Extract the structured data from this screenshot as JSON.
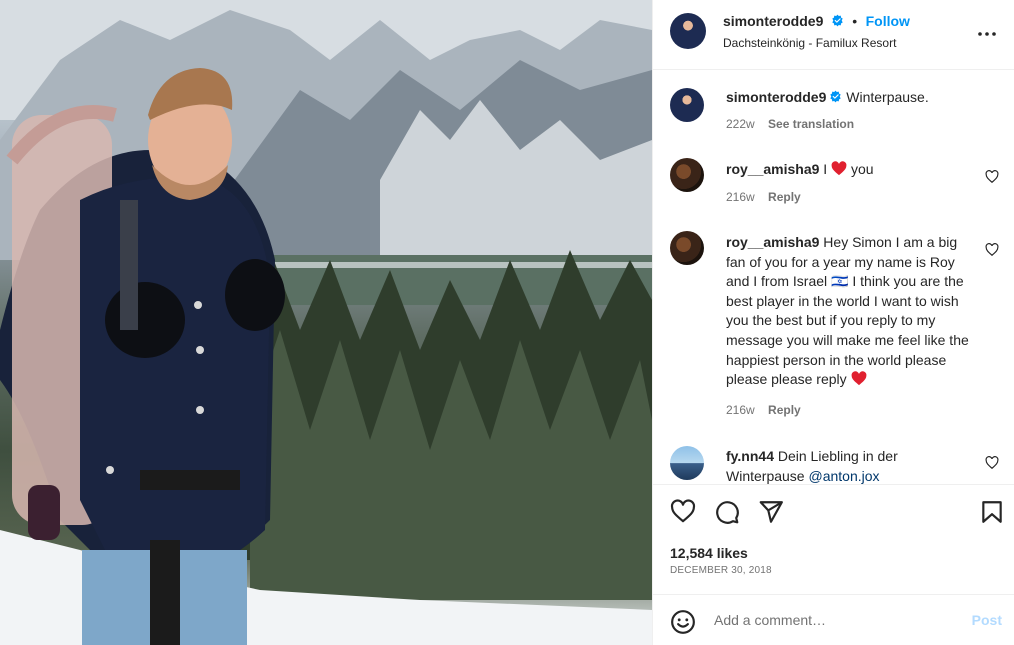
{
  "post": {
    "owner": {
      "username": "simonterodde9",
      "follow_label": "Follow",
      "separator": "•",
      "location": "Dachsteinkönig - Familux Resort"
    },
    "caption": {
      "username": "simonterodde9",
      "text": "Winterpause.",
      "age": "222w",
      "translate_label": "See translation"
    },
    "comments": [
      {
        "username": "roy__amisha9",
        "text_before": "I",
        "text_after": "you",
        "age": "216w",
        "reply_label": "Reply"
      },
      {
        "username": "roy__amisha9",
        "text": "Hey Simon I am a big fan of you for a year my name is Roy and I from Israel 🇮🇱 I think you are the best player in the world I want to wish you the best but if you reply to my message you will make me feel like the happiest person in the world please please please reply",
        "age": "216w",
        "reply_label": "Reply"
      },
      {
        "username": "fy.nn44",
        "text": "Dein Liebling in der Winterpause",
        "mention": "@anton.jox"
      }
    ],
    "likes": "12,584 likes",
    "date": "December 30, 2018",
    "add_comment_placeholder": "Add a comment…",
    "post_label": "Post",
    "colors": {
      "accent": "#0095f6",
      "verified": "#0095f6",
      "heart": "#ff3040",
      "post_disabled": "#b3dbff"
    }
  }
}
